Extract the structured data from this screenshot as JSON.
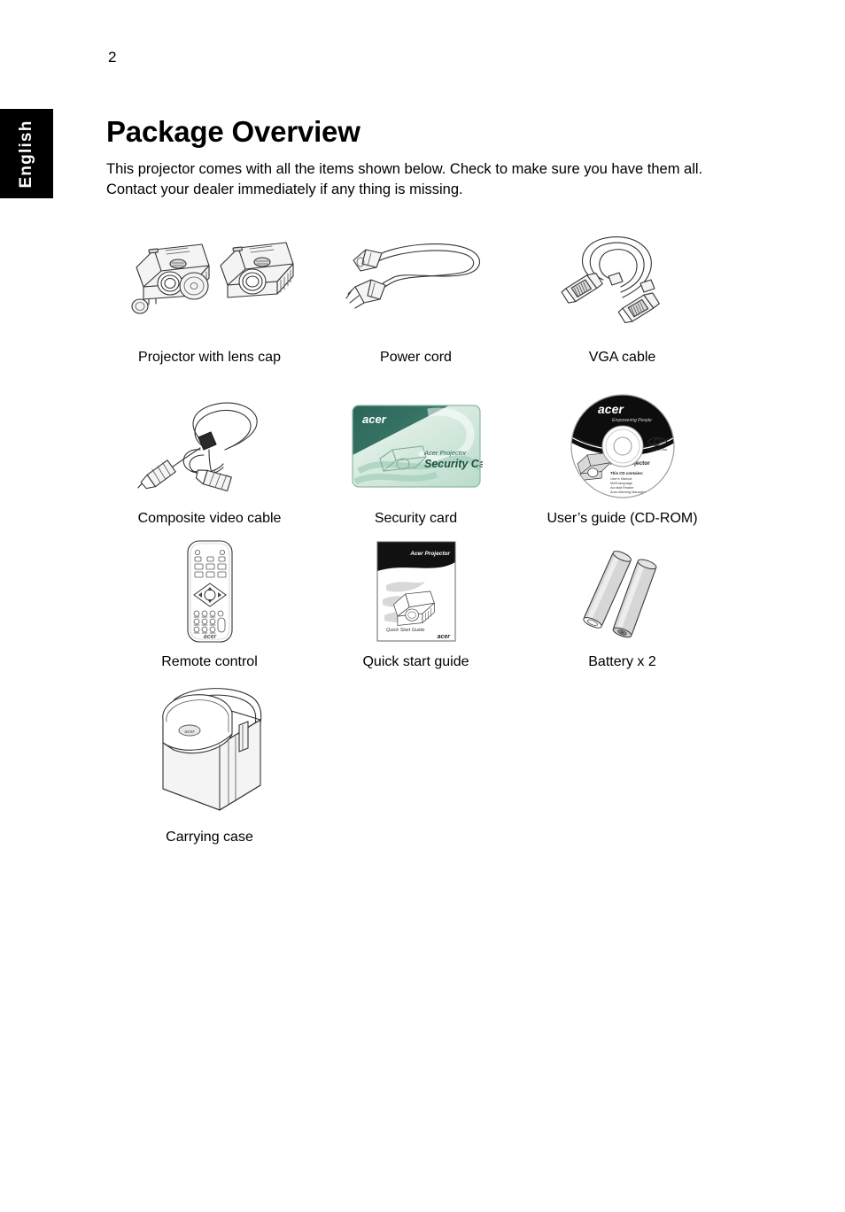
{
  "page": {
    "number": "2",
    "language_tab": "English",
    "title": "Package Overview",
    "intro": "This projector comes with all the items shown below. Check to make sure you have them all. Contact your dealer immediately if any thing is missing."
  },
  "items": [
    {
      "id": "projector-with-lens-cap",
      "caption": "Projector with lens cap"
    },
    {
      "id": "power-cord",
      "caption": "Power cord"
    },
    {
      "id": "vga-cable",
      "caption": "VGA cable"
    },
    {
      "id": "composite-video-cable",
      "caption": "Composite video cable"
    },
    {
      "id": "security-card",
      "caption": "Security card"
    },
    {
      "id": "users-guide-cdrom",
      "caption": "User’s guide (CD-ROM)"
    },
    {
      "id": "remote-control",
      "caption": "Remote control"
    },
    {
      "id": "quick-start-guide",
      "caption": "Quick start guide"
    },
    {
      "id": "battery",
      "caption": "Battery x 2"
    },
    {
      "id": "carrying-case",
      "caption": "Carrying case"
    }
  ],
  "artwork_text": {
    "security_card": {
      "brand": "acer",
      "line1": "Acer Projector",
      "line2": "Security Card"
    },
    "cdrom": {
      "brand": "acer",
      "tagline": "Empowering People",
      "product": "Acer Projector",
      "contents_heading": "This CD contains:",
      "contents": [
        "User’s Manual",
        "Multi-language",
        "Acrobat Reader",
        "Auto-Warning Management"
      ]
    },
    "quick_start_guide": {
      "header": "Acer Projector",
      "footer": "Quick Start Guide",
      "brand": "acer"
    },
    "remote_control": {
      "brand": "acer"
    }
  },
  "colors": {
    "tab_background": "#000000",
    "tab_text": "#ffffff",
    "text": "#000000",
    "line_art": "#333333",
    "card_header_green": "#2d6b5f",
    "card_body_mint": "#d7e9df",
    "cd_black": "#0d0d0d",
    "battery_gray": "#d5d5d5"
  }
}
